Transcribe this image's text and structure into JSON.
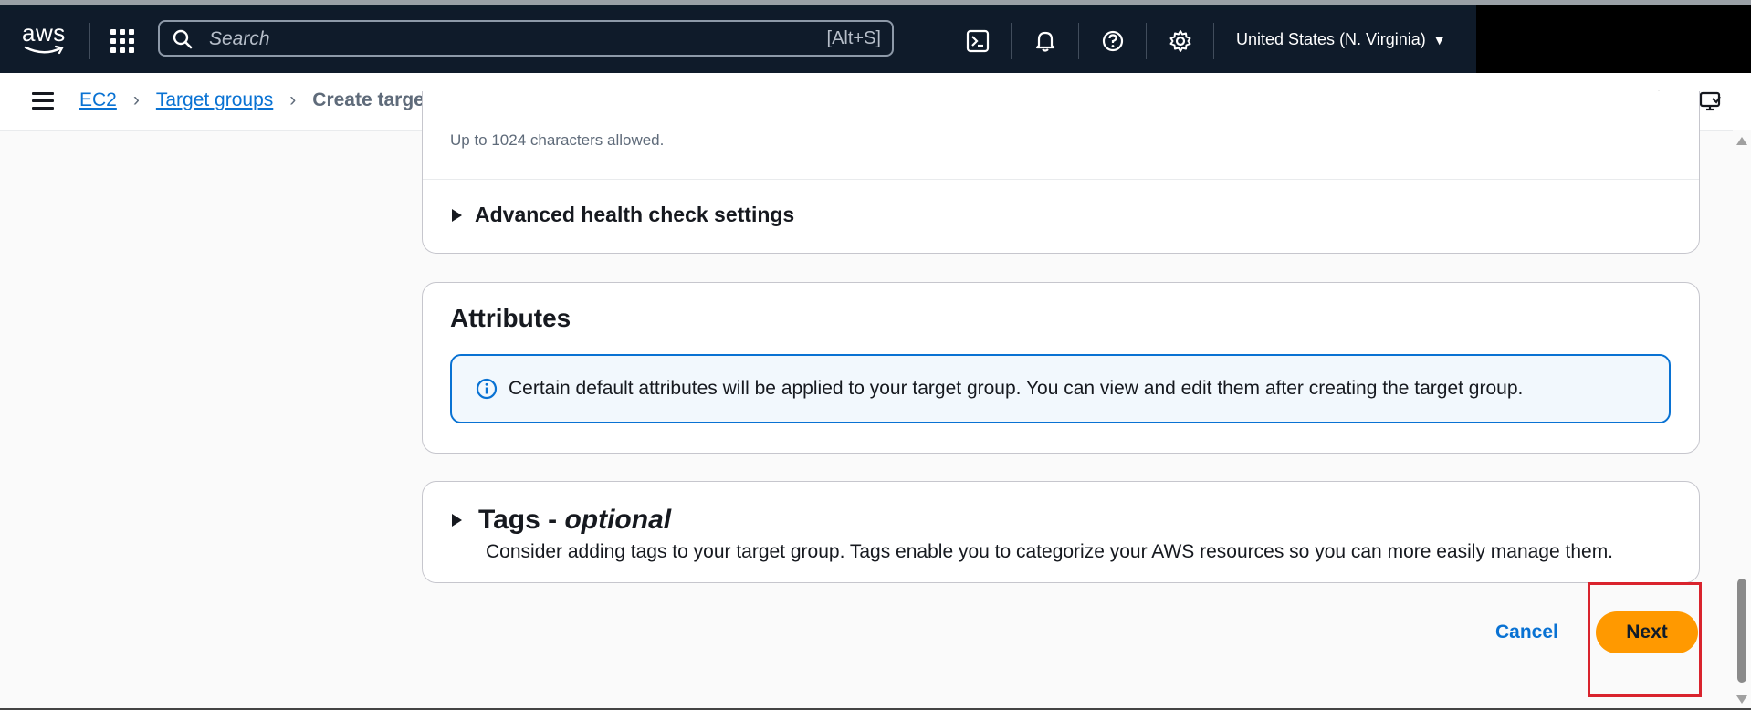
{
  "topnav": {
    "logo_text": "aws",
    "search": {
      "placeholder": "Search",
      "value": "",
      "shortcut": "[Alt+S]"
    },
    "icons": [
      "cloudshell-icon",
      "bell-icon",
      "help-icon",
      "gear-icon"
    ],
    "region_label": "United States (N. Virginia)",
    "region_caret": "▼"
  },
  "breadcrumb": {
    "items": [
      {
        "label": "EC2"
      },
      {
        "label": "Target groups"
      }
    ],
    "separator": "›",
    "current": "Create target group"
  },
  "health_check": {
    "helper_text": "Up to 1024 characters allowed.",
    "advanced_label": "Advanced health check settings"
  },
  "attributes": {
    "title": "Attributes",
    "info_text": "Certain default attributes will be applied to your target group. You can view and edit them after creating the target group."
  },
  "tags": {
    "title": "Tags - ",
    "title_optional": "optional",
    "description": "Consider adding tags to your target group. Tags enable you to categorize your AWS resources so you can more easily manage them."
  },
  "actions": {
    "cancel_label": "Cancel",
    "next_label": "Next"
  },
  "colors": {
    "nav_bg": "#0f1b2a",
    "link": "#0972d3",
    "primary_button": "#ff9900",
    "highlight": "#d9232d"
  }
}
